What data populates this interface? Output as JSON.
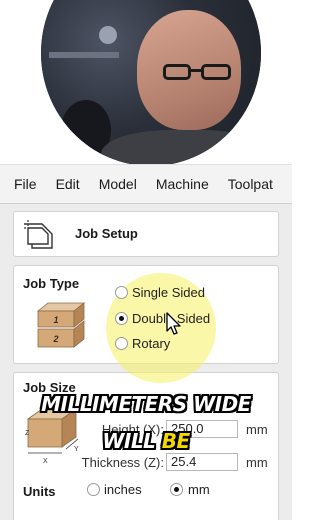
{
  "menu": [
    "File",
    "Edit",
    "Model",
    "Machine",
    "Toolpat"
  ],
  "job_setup": {
    "title": "Job Setup"
  },
  "job_type": {
    "label": "Job Type",
    "options": [
      "Single Sided",
      "Double Sided",
      "Rotary"
    ],
    "selected": "Double Sided",
    "icon_numbers": [
      "1",
      "2"
    ]
  },
  "job_size": {
    "label": "Job Size",
    "height_label": "Height (X):",
    "height_value": "250.0",
    "height_unit": "mm",
    "thickness_label": "Thickness (Z):",
    "thickness_value": "25.4",
    "thickness_unit": "mm",
    "axis_labels": [
      "Z",
      "X",
      "Y"
    ],
    "units_label": "Units",
    "unit_options": [
      "inches",
      "mm"
    ],
    "unit_selected": "mm"
  },
  "caption": {
    "line1": "MILLIMETERS WIDE",
    "line2_a": "WILL ",
    "line2_b": "BE"
  },
  "colors": {
    "highlight": "#f8f060",
    "caption_accent": "#f4d900"
  }
}
